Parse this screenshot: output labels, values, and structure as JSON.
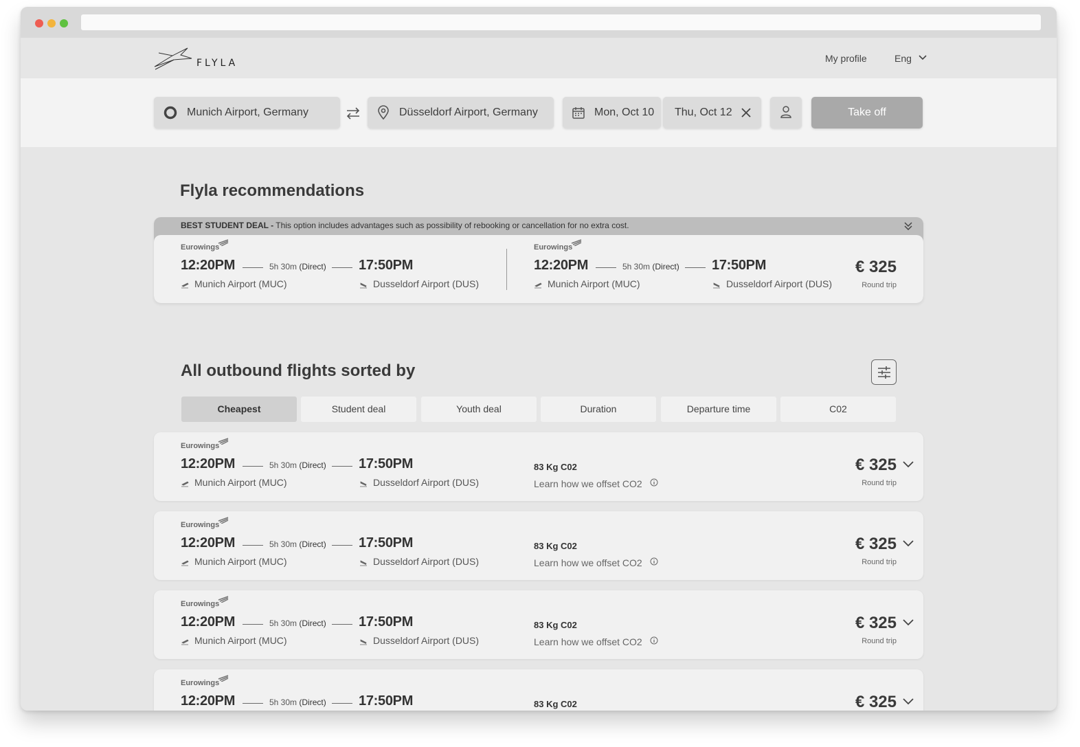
{
  "header": {
    "brand": "FLYLA",
    "profile_label": "My profile",
    "language": "Eng"
  },
  "search": {
    "from": "Munich Airport, Germany",
    "to": "Düsseldorf Airport, Germany",
    "depart_date": "Mon, Oct 10",
    "return_date": "Thu, Oct 12",
    "submit_label": "Take off"
  },
  "recommendations": {
    "title": "Flyla recommendations",
    "banner_strong": "BEST STUDENT DEAL -",
    "banner_text": " This option includes advantages such as possibility of rebooking or cancellation for no extra cost.",
    "legs": [
      {
        "airline": "Eurowings",
        "dep_time": "12:20PM",
        "duration": "5h 30m",
        "stops": "(Direct)",
        "arr_time": "17:50PM",
        "dep_airport": "Munich Airport (MUC)",
        "arr_airport": "Dusseldorf Airport (DUS)"
      },
      {
        "airline": "Eurowings",
        "dep_time": "12:20PM",
        "duration": "5h 30m",
        "stops": "(Direct)",
        "arr_time": "17:50PM",
        "dep_airport": "Munich Airport (MUC)",
        "arr_airport": "Dusseldorf Airport (DUS)"
      }
    ],
    "price": "€ 325",
    "price_note": "Round trip"
  },
  "outbound": {
    "title": "All outbound flights sorted by",
    "sort_tabs": [
      "Cheapest",
      "Student deal",
      "Youth deal",
      "Duration",
      "Departure time",
      "C02"
    ],
    "active_tab": "Cheapest",
    "flights": [
      {
        "airline": "Eurowings",
        "dep_time": "12:20PM",
        "duration": "5h 30m",
        "stops": "(Direct)",
        "arr_time": "17:50PM",
        "dep_airport": "Munich Airport (MUC)",
        "arr_airport": "Dusseldorf Airport (DUS)",
        "co2": "83 Kg C02",
        "co2_link": "Learn how we offset CO2",
        "price": "€ 325",
        "price_note": "Round trip"
      },
      {
        "airline": "Eurowings",
        "dep_time": "12:20PM",
        "duration": "5h 30m",
        "stops": "(Direct)",
        "arr_time": "17:50PM",
        "dep_airport": "Munich Airport (MUC)",
        "arr_airport": "Dusseldorf Airport (DUS)",
        "co2": "83 Kg C02",
        "co2_link": "Learn how we offset CO2",
        "price": "€ 325",
        "price_note": "Round trip"
      },
      {
        "airline": "Eurowings",
        "dep_time": "12:20PM",
        "duration": "5h 30m",
        "stops": "(Direct)",
        "arr_time": "17:50PM",
        "dep_airport": "Munich Airport (MUC)",
        "arr_airport": "Dusseldorf Airport (DUS)",
        "co2": "83 Kg C02",
        "co2_link": "Learn how we offset CO2",
        "price": "€ 325",
        "price_note": "Round trip"
      },
      {
        "airline": "Eurowings",
        "dep_time": "12:20PM",
        "duration": "5h 30m",
        "stops": "(Direct)",
        "arr_time": "17:50PM",
        "co2": "83 Kg C02",
        "price": "€ 325"
      }
    ]
  },
  "icons": {
    "origin": "circle-origin-icon",
    "destination": "location-pin-icon",
    "swap": "swap-arrows-icon",
    "calendar": "calendar-icon",
    "clear": "close-icon",
    "passenger": "person-icon",
    "filter": "sliders-icon",
    "expand": "chevron-down-icon",
    "collapse": "double-chevron-down-icon",
    "info": "info-icon",
    "departure": "plane-departure-icon",
    "arrival": "plane-arrival-icon"
  },
  "colors": {
    "page_bg": "#e6e6e6",
    "card_bg": "#f1f1f1",
    "banner_bg": "#bdbdbd",
    "button_bg": "#a9a9a9",
    "active_tab_bg": "#d0d0d0"
  }
}
